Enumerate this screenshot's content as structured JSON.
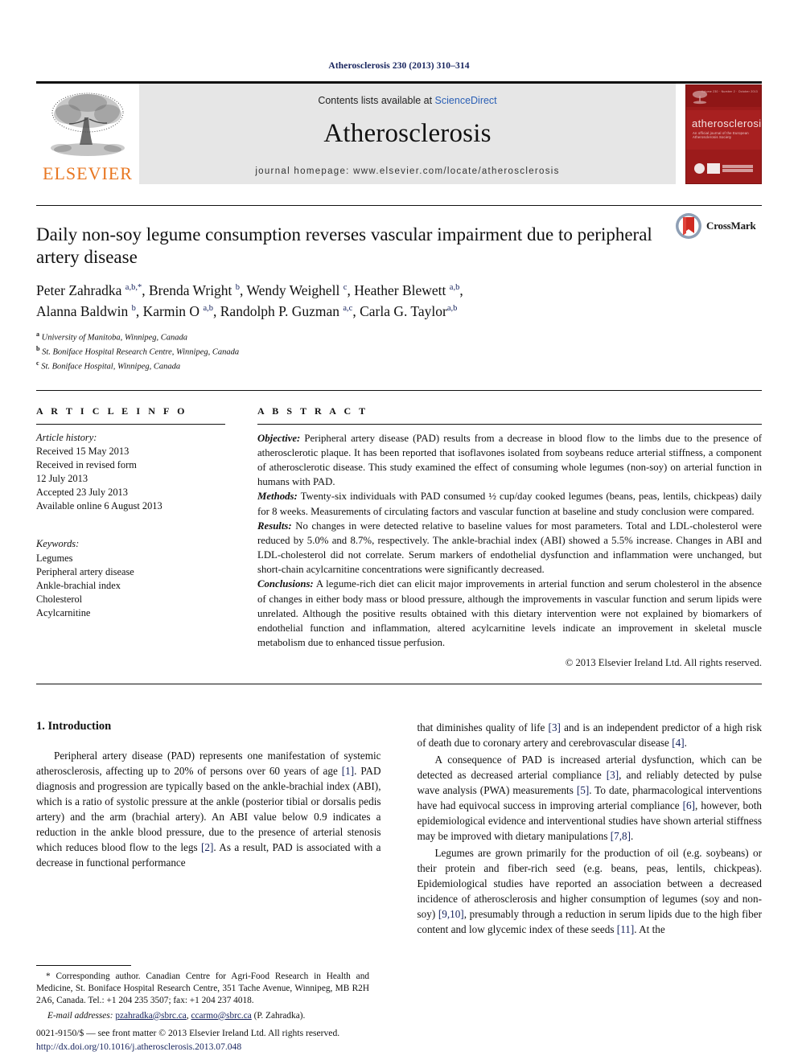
{
  "running_head": "Atherosclerosis 230 (2013) 310–314",
  "masthead": {
    "publisher_name": "ELSEVIER",
    "contents_prefix": "Contents lists available at ",
    "contents_link": "ScienceDirect",
    "journal_title": "Atherosclerosis",
    "homepage": "journal homepage: www.elsevier.com/locate/atherosclerosis",
    "cover": {
      "title": "atherosclerosis",
      "subtitle": "An official journal of the European Atherosclerosis Society",
      "top_row": "Volume 230 · Number 2 · October 2013"
    },
    "link_color": "#2b5fb5",
    "brand_color": "#E87722"
  },
  "article": {
    "title": "Daily non-soy legume consumption reverses vascular impairment due to peripheral artery disease",
    "crossmark_label": "CrossMark",
    "authors_line1": "Peter Zahradka a,b,*, Brenda Wright b, Wendy Weighell c, Heather Blewett a,b,",
    "authors_line2": "Alanna Baldwin b, Karmin O a,b, Randolph P. Guzman a,c, Carla G. Taylor a,b",
    "authors": [
      {
        "name": "Peter Zahradka",
        "sup": "a,b,*"
      },
      {
        "name": "Brenda Wright",
        "sup": "b"
      },
      {
        "name": "Wendy Weighell",
        "sup": "c"
      },
      {
        "name": "Heather Blewett",
        "sup": "a,b"
      },
      {
        "name": "Alanna Baldwin",
        "sup": "b"
      },
      {
        "name": "Karmin O",
        "sup": "a,b"
      },
      {
        "name": "Randolph P. Guzman",
        "sup": "a,c"
      },
      {
        "name": "Carla G. Taylor",
        "sup": "a,b"
      }
    ],
    "affiliations": [
      {
        "sup": "a",
        "text": "University of Manitoba, Winnipeg, Canada"
      },
      {
        "sup": "b",
        "text": "St. Boniface Hospital Research Centre, Winnipeg, Canada"
      },
      {
        "sup": "c",
        "text": "St. Boniface Hospital, Winnipeg, Canada"
      }
    ]
  },
  "article_info": {
    "heading": "A R T I C L E   I N F O",
    "history_label": "Article history:",
    "history": [
      "Received 15 May 2013",
      "Received in revised form",
      "12 July 2013",
      "Accepted 23 July 2013",
      "Available online 6 August 2013"
    ],
    "keywords_label": "Keywords:",
    "keywords": [
      "Legumes",
      "Peripheral artery disease",
      "Ankle-brachial index",
      "Cholesterol",
      "Acylcarnitine"
    ]
  },
  "abstract": {
    "heading": "A B S T R A C T",
    "sections": [
      {
        "label": "Objective:",
        "text": " Peripheral artery disease (PAD) results from a decrease in blood flow to the limbs due to the presence of atherosclerotic plaque. It has been reported that isoflavones isolated from soybeans reduce arterial stiffness, a component of atherosclerotic disease. This study examined the effect of consuming whole legumes (non-soy) on arterial function in humans with PAD."
      },
      {
        "label": "Methods:",
        "text": " Twenty-six individuals with PAD consumed ½ cup/day cooked legumes (beans, peas, lentils, chickpeas) daily for 8 weeks. Measurements of circulating factors and vascular function at baseline and study conclusion were compared."
      },
      {
        "label": "Results:",
        "text": " No changes in were detected relative to baseline values for most parameters. Total and LDL-cholesterol were reduced by 5.0% and 8.7%, respectively. The ankle-brachial index (ABI) showed a 5.5% increase. Changes in ABI and LDL-cholesterol did not correlate. Serum markers of endothelial dysfunction and inflammation were unchanged, but short-chain acylcarnitine concentrations were significantly decreased."
      },
      {
        "label": "Conclusions:",
        "text": " A legume-rich diet can elicit major improvements in arterial function and serum cholesterol in the absence of changes in either body mass or blood pressure, although the improvements in vascular function and serum lipids were unrelated. Although the positive results obtained with this dietary intervention were not explained by biomarkers of endothelial function and inflammation, altered acylcarnitine levels indicate an improvement in skeletal muscle metabolism due to enhanced tissue perfusion."
      }
    ],
    "copyright": "© 2013 Elsevier Ireland Ltd. All rights reserved."
  },
  "body": {
    "section_number_title": "1. Introduction",
    "left_paragraphs": [
      "Peripheral artery disease (PAD) represents one manifestation of systemic atherosclerosis, affecting up to 20% of persons over 60 years of age [1]. PAD diagnosis and progression are typically based on the ankle-brachial index (ABI), which is a ratio of systolic pressure at the ankle (posterior tibial or dorsalis pedis artery) and the arm (brachial artery). An ABI value below 0.9 indicates a reduction in the ankle blood pressure, due to the presence of arterial stenosis which reduces blood flow to the legs [2]. As a result, PAD is associated with a decrease in functional performance"
    ],
    "right_paragraphs": [
      "that diminishes quality of life [3] and is an independent predictor of a high risk of death due to coronary artery and cerebrovascular disease [4].",
      "A consequence of PAD is increased arterial dysfunction, which can be detected as decreased arterial compliance [3], and reliably detected by pulse wave analysis (PWA) measurements [5]. To date, pharmacological interventions have had equivocal success in improving arterial compliance [6], however, both epidemiological evidence and interventional studies have shown arterial stiffness may be improved with dietary manipulations [7,8].",
      "Legumes are grown primarily for the production of oil (e.g. soybeans) or their protein and fiber-rich seed (e.g. beans, peas, lentils, chickpeas). Epidemiological studies have reported an association between a decreased incidence of atherosclerosis and higher consumption of legumes (soy and non-soy) [9,10], presumably through a reduction in serum lipids due to the high fiber content and low glycemic index of these seeds [11]. At the"
    ]
  },
  "footnotes": {
    "corresponding": "* Corresponding author. Canadian Centre for Agri-Food Research in Health and Medicine, St. Boniface Hospital Research Centre, 351 Tache Avenue, Winnipeg, MB R2H 2A6, Canada. Tel.: +1 204 235 3507; fax: +1 204 237 4018.",
    "email_label": "E-mail addresses:",
    "email_1": "pzahradka@sbrc.ca",
    "email_2": "ccarmo@sbrc.ca",
    "email_suffix": " (P. Zahradka).",
    "front_matter": "0021-9150/$ — see front matter © 2013 Elsevier Ireland Ltd. All rights reserved.",
    "doi": "http://dx.doi.org/10.1016/j.atherosclerosis.2013.07.048"
  }
}
